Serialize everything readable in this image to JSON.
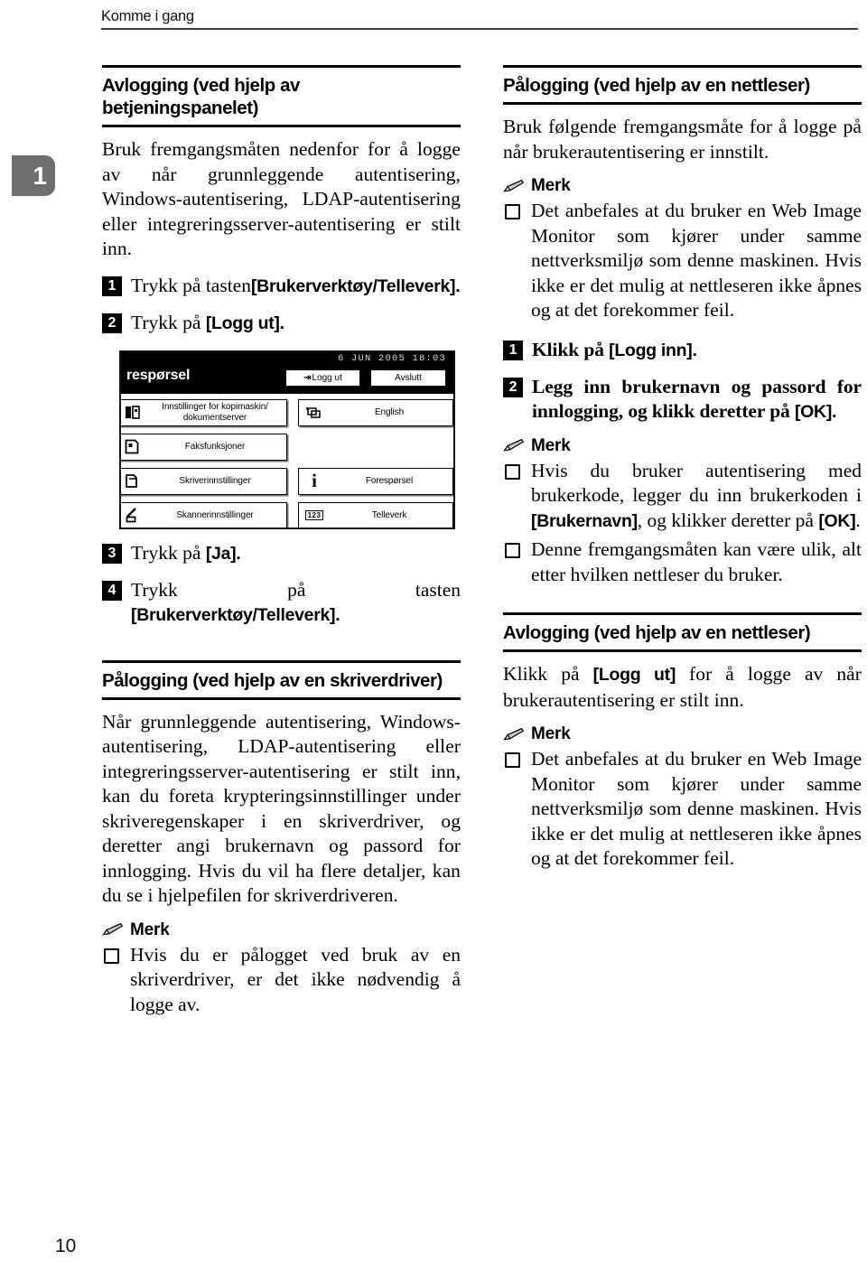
{
  "running_head": {
    "text": "Komme i gang"
  },
  "chapter_tab": {
    "number": "1"
  },
  "folio": {
    "page_number": "10"
  },
  "left_column": {
    "section1": {
      "title": "Avlogging (ved hjelp av betjeningspanelet)",
      "intro": "Bruk fremgangsmåten nedenfor for å logge av når grunnleggende autentisering, Windows-autentisering, LDAP-autentisering eller integreringsserver-autentisering er stilt inn.",
      "steps": [
        {
          "number": "1",
          "text_before": "Trykk på tasten",
          "ui": "[Brukerverktøy/Telleverk]",
          "text_after": "."
        },
        {
          "number": "2",
          "text_before": "Trykk på ",
          "ui": "[Logg ut]",
          "text_after": "."
        },
        {
          "number": "3",
          "text_before": "Trykk på ",
          "ui": "[Ja]",
          "text_after": "."
        },
        {
          "number": "4",
          "text_before": "Trykk på tasten ",
          "ui": "[Brukerverktøy/Telleverk]",
          "text_after": "."
        }
      ]
    },
    "lcd": {
      "date": "6 JUN  2005 18:03",
      "screen_title": "respørsel",
      "logout_button": "Logg ut",
      "exit_button": "Avslutt",
      "cells": [
        {
          "icon": "copier-document-server-icon",
          "label": "Innstillinger for kopimaskin/ dokumentserver"
        },
        {
          "icon": "fax-icon",
          "label": "Faksfunksjoner"
        },
        {
          "icon": "printer-icon",
          "label": "Skriverinnstillinger"
        },
        {
          "icon": "scanner-icon",
          "label": "Skannerinnstillinger"
        },
        {
          "icon": "language-icon",
          "label": "English"
        },
        {
          "icon": "info-icon",
          "label": "Forespørsel"
        },
        {
          "icon": "counter-123-icon",
          "label": "Telleverk"
        }
      ]
    },
    "section2": {
      "title": "Pålogging (ved hjelp av en skriverdriver)",
      "body": "Når grunnleggende autentisering, Windows-autentisering, LDAP-autentisering eller integreringsserver-autentisering er stilt inn, kan du foreta krypteringsinnstillinger under skriveregenskaper i en skriverdriver, og deretter angi brukernavn og passord for innlogging. Hvis du vil ha flere detaljer, kan du se i hjelpefilen for skriverdriveren.",
      "note": {
        "title": "Merk",
        "items": [
          {
            "text": "Hvis du er pålogget ved bruk av en skriverdriver, er det ikke nødvendig å logge av."
          }
        ]
      }
    }
  },
  "right_column": {
    "section1": {
      "title": "Pålogging (ved hjelp av en nettleser)",
      "intro": "Bruk følgende fremgangsmåte for å logge på når brukerautentisering er innstilt.",
      "note_top": {
        "title": "Merk",
        "items": [
          {
            "text": "Det anbefales at du bruker en Web Image Monitor som kjører under samme nettverksmiljø som denne maskinen. Hvis ikke er det mulig at nettleseren ikke åpnes og at det forekommer feil."
          }
        ]
      },
      "steps": [
        {
          "number": "1",
          "text_before": "Klikk på ",
          "ui": "[Logg inn]",
          "text_after": "."
        },
        {
          "number": "2",
          "text_before": "Legg inn brukernavn og passord for innlogging, og klikk deretter på ",
          "ui": "[OK]",
          "text_after": "."
        }
      ],
      "note_bottom": {
        "title": "Merk",
        "items": [
          {
            "prefix": "Hvis du bruker autentisering med brukerkode, legger du inn brukerkoden i ",
            "ui1": "[Brukernavn]",
            "middle": ", og klikker deretter på ",
            "ui2": "[OK]",
            "suffix": "."
          },
          {
            "text": "Denne fremgangsmåten kan være ulik, alt etter hvilken nettleser du bruker."
          }
        ]
      }
    },
    "section2": {
      "title": "Avlogging (ved hjelp av en nettleser)",
      "body_before": "Klikk på ",
      "body_ui": "[Logg ut]",
      "body_after": " for å logge av når brukerautentisering er stilt inn.",
      "note": {
        "title": "Merk",
        "items": [
          {
            "text": "Det anbefales at du bruker en Web Image Monitor som kjører under samme nettverksmiljø som denne maskinen. Hvis ikke er det mulig at nettleseren ikke åpnes og at det forekommer feil."
          }
        ]
      }
    }
  }
}
